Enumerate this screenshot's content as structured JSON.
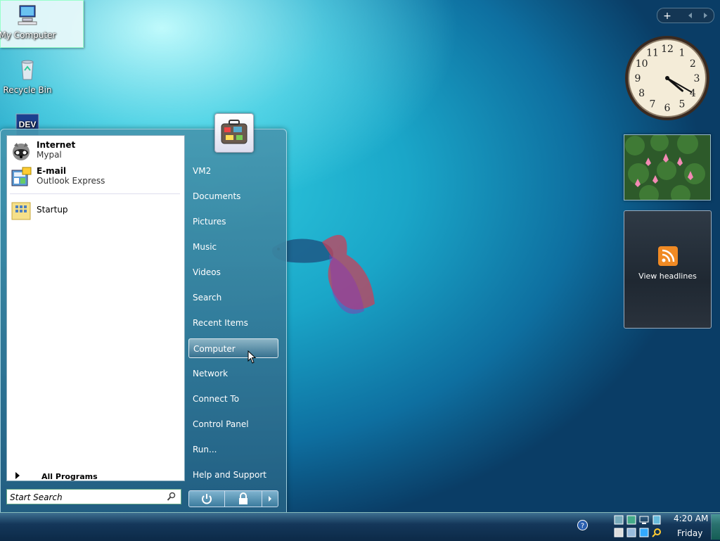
{
  "desktop": {
    "icons": [
      {
        "label": "My Computer"
      },
      {
        "label": "Recycle Bin"
      },
      {
        "label": "DEV"
      }
    ]
  },
  "start_menu": {
    "pinned": [
      {
        "title": "Internet",
        "subtitle": "Mypal"
      },
      {
        "title": "E-mail",
        "subtitle": "Outlook Express"
      }
    ],
    "recent": [
      {
        "title": "Startup"
      }
    ],
    "all_programs": "All Programs",
    "search_placeholder": "Start Search",
    "right_items": [
      "VM2",
      "Documents",
      "Pictures",
      "Music",
      "Videos",
      "Search",
      "Recent Items",
      "Computer",
      "Network",
      "Connect To",
      "Control Panel",
      "Run...",
      "Help and Support"
    ],
    "highlighted_item": "Computer"
  },
  "sidebar": {
    "clock": {
      "hour": 4,
      "minute": 20
    },
    "feed_label": "View headlines"
  },
  "taskbar": {
    "time": "4:20 AM",
    "day": "Friday"
  },
  "colors": {
    "accent": "#1aa6c8",
    "rss": "#f08a24"
  }
}
